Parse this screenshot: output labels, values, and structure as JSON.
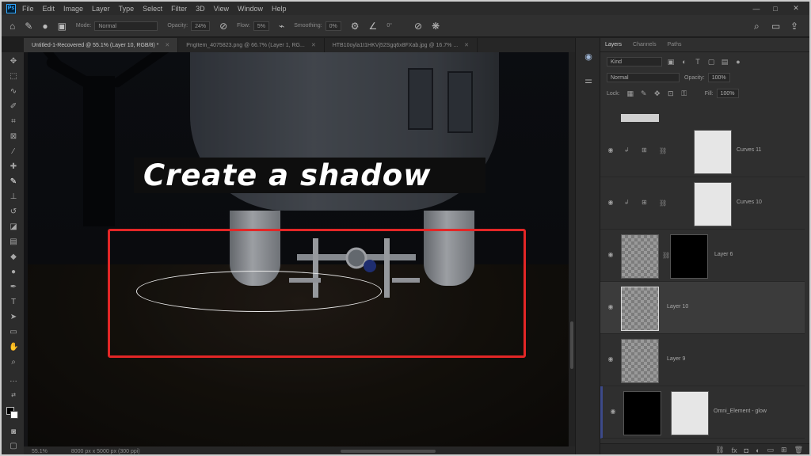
{
  "menubar": {
    "items": [
      "File",
      "Edit",
      "Image",
      "Layer",
      "Type",
      "Select",
      "Filter",
      "3D",
      "View",
      "Window",
      "Help"
    ],
    "window_controls": [
      "—",
      "□",
      "✕"
    ]
  },
  "options": {
    "mode_label": "Mode:",
    "mode_value": "Normal",
    "opacity_label": "Opacity:",
    "opacity_value": "24%",
    "flow_label": "Flow:",
    "flow_value": "5%",
    "smoothing_label": "Smoothing:",
    "smoothing_value": "0%",
    "angle_value": "0°"
  },
  "tabs": [
    {
      "label": "Untitled-1-Recovered @ 55.1% (Layer 10, RGB/8) *"
    },
    {
      "label": "PngItem_4075823.png @ 66.7% (Layer 1, RG..."
    },
    {
      "label": "HTB10oyla1t1HKVj52Sgq6x8FXab.jpg @ 16.7% ..."
    }
  ],
  "canvas": {
    "overlay_title": "Create a shadow"
  },
  "status": {
    "zoom": "55.1%",
    "doc_info": "8000 px x 5000 px (300 ppi)"
  },
  "panel": {
    "tabs": [
      "Layers",
      "Channels",
      "Paths"
    ],
    "filter_kind": "Kind",
    "blend_mode": "Normal",
    "opacity_label": "Opacity:",
    "opacity_value": "100%",
    "lock_label": "Lock:",
    "fill_label": "Fill:",
    "fill_value": "100%"
  },
  "layers": [
    {
      "name": "Curves 11",
      "kind": "adjustment"
    },
    {
      "name": "Curves 10",
      "kind": "adjustment"
    },
    {
      "name": "Layer 6",
      "kind": "masked"
    },
    {
      "name": "Layer 10",
      "kind": "pixel",
      "selected": true
    },
    {
      "name": "Layer 9",
      "kind": "pixel"
    },
    {
      "name": "Omni_Element - glow",
      "kind": "masked-dark"
    }
  ],
  "colors": {
    "highlight": "#e32626",
    "panel_bg": "#2f2f2f",
    "accent": "#31a8ff"
  }
}
